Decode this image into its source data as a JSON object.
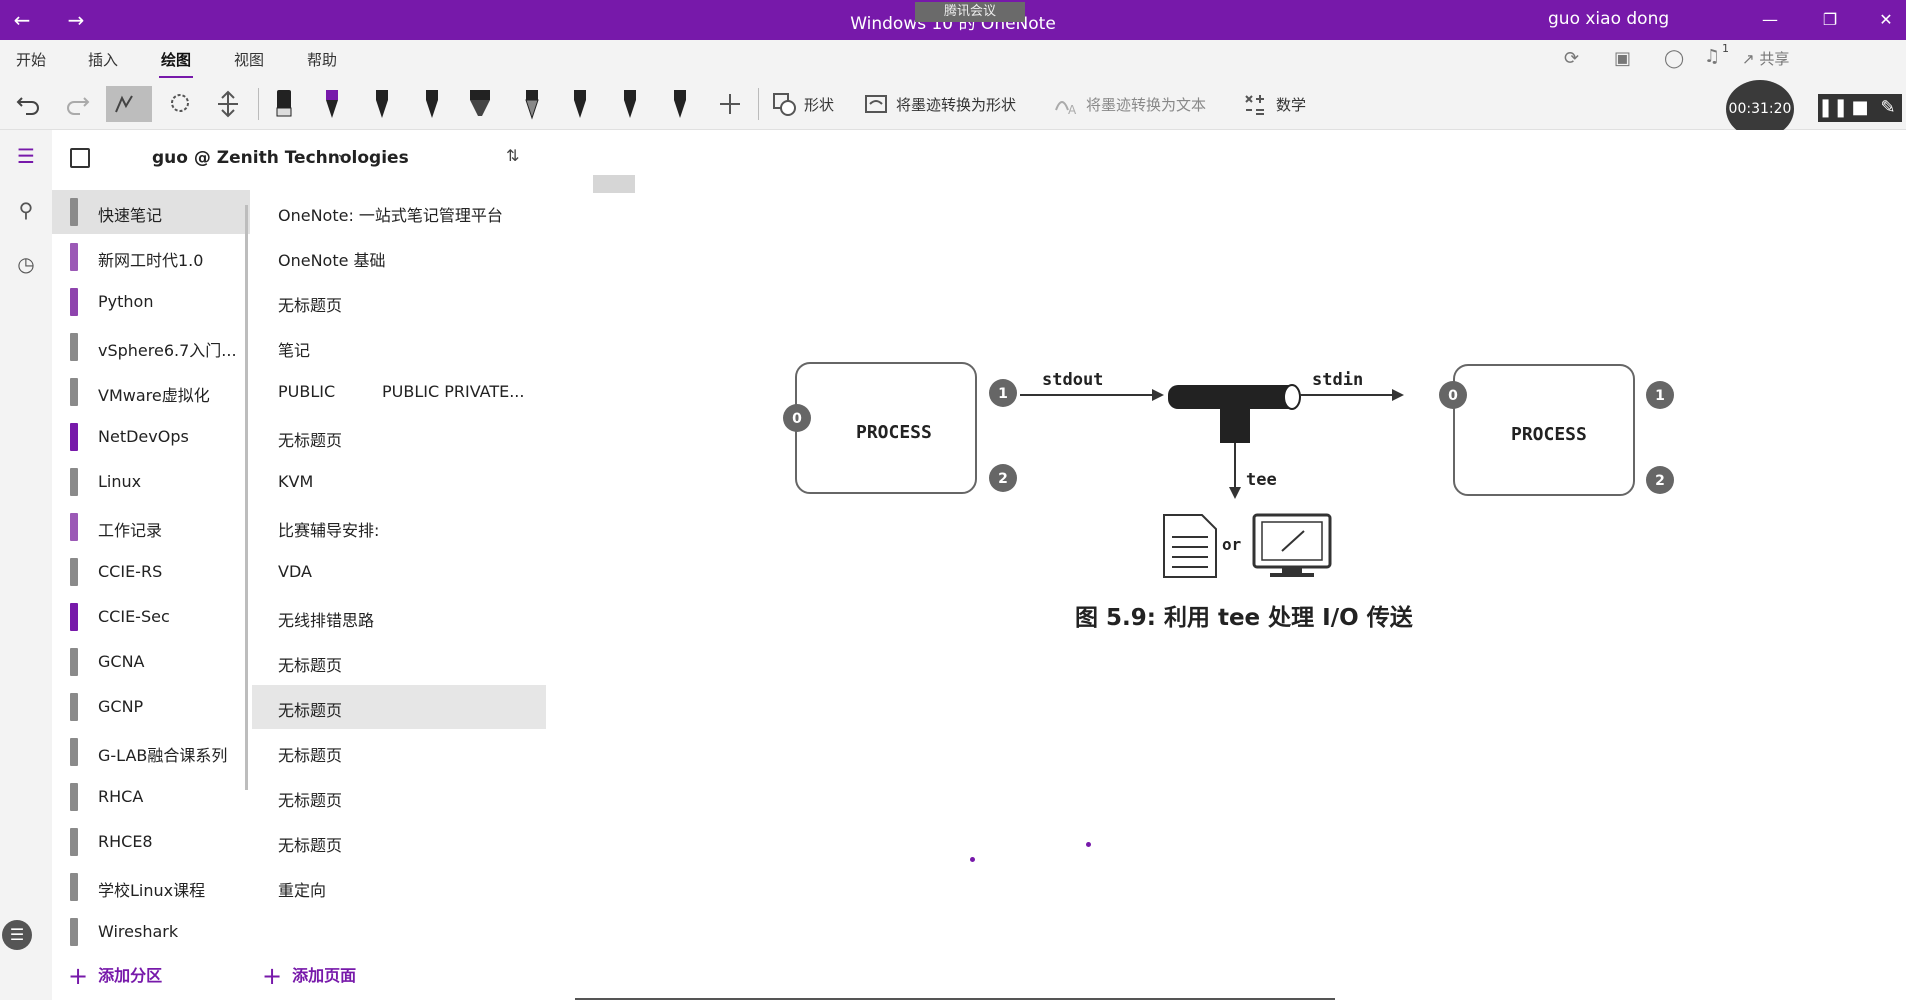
{
  "titlebar": {
    "title": "Windows 10 的 OneNote",
    "meeting": "腾讯会议",
    "user": "guo xiao dong"
  },
  "ribbon": {
    "tabs": [
      {
        "label": "开始"
      },
      {
        "label": "插入"
      },
      {
        "label": "绘图"
      },
      {
        "label": "视图"
      },
      {
        "label": "帮助"
      }
    ],
    "active_tab": "绘图",
    "share_label": "共享",
    "notification_count": "1",
    "shapes_label": "形状",
    "ink_to_shape": "将墨迹转换为形状",
    "ink_to_text": "将墨迹转换为文本",
    "math_label": "数学"
  },
  "recorder": {
    "time": "00:31:20"
  },
  "notebook": {
    "name": "guo @ Zenith Technologies"
  },
  "sections": [
    {
      "label": "快速笔记",
      "color": "#8a8a8a"
    },
    {
      "label": "新网工时代1.0",
      "color": "#9b59b6"
    },
    {
      "label": "Python",
      "color": "#8e44ad"
    },
    {
      "label": "vSphere6.7入门...",
      "color": "#8a8a8a"
    },
    {
      "label": "VMware虚拟化",
      "color": "#8a8a8a"
    },
    {
      "label": "NetDevOps",
      "color": "#7719aa"
    },
    {
      "label": "Linux",
      "color": "#8a8a8a"
    },
    {
      "label": "工作记录",
      "color": "#9b59b6"
    },
    {
      "label": "CCIE-RS",
      "color": "#8a8a8a"
    },
    {
      "label": "CCIE-Sec",
      "color": "#7719aa"
    },
    {
      "label": "GCNA",
      "color": "#8a8a8a"
    },
    {
      "label": "GCNP",
      "color": "#8a8a8a"
    },
    {
      "label": "G-LAB融合课系列",
      "color": "#8a8a8a"
    },
    {
      "label": "RHCA",
      "color": "#8a8a8a"
    },
    {
      "label": "RHCE8",
      "color": "#8a8a8a"
    },
    {
      "label": "学校Linux课程",
      "color": "#8a8a8a"
    },
    {
      "label": "Wireshark",
      "color": "#8a8a8a"
    }
  ],
  "pages": [
    {
      "label": "OneNote: 一站式笔记管理平台",
      "label2": ""
    },
    {
      "label": "OneNote 基础",
      "label2": ""
    },
    {
      "label": "无标题页",
      "label2": ""
    },
    {
      "label": "笔记",
      "label2": ""
    },
    {
      "label": "PUBLIC",
      "label2": "PUBLIC PRIVATE..."
    },
    {
      "label": "无标题页",
      "label2": ""
    },
    {
      "label": "KVM",
      "label2": ""
    },
    {
      "label": "比赛辅导安排:",
      "label2": ""
    },
    {
      "label": "VDA",
      "label2": ""
    },
    {
      "label": "无线排错思路",
      "label2": ""
    },
    {
      "label": "无标题页",
      "label2": ""
    },
    {
      "label": "无标题页",
      "label2": ""
    },
    {
      "label": "无标题页",
      "label2": ""
    },
    {
      "label": "无标题页",
      "label2": ""
    },
    {
      "label": "无标题页",
      "label2": ""
    },
    {
      "label": "重定向",
      "label2": ""
    }
  ],
  "add_section": "添加分区",
  "add_page": "添加页面",
  "diagram": {
    "left_process": "PROCESS",
    "right_process": "PROCESS",
    "stdout": "stdout",
    "stdin": "stdin",
    "tee": "tee",
    "or": "or",
    "fd0": "0",
    "fd1": "1",
    "fd2": "2",
    "caption": "图 5.9: 利用 tee 处理 I/O 传送"
  },
  "colors": {
    "titlebar": "#7719aa",
    "accent": "#7719aa"
  }
}
